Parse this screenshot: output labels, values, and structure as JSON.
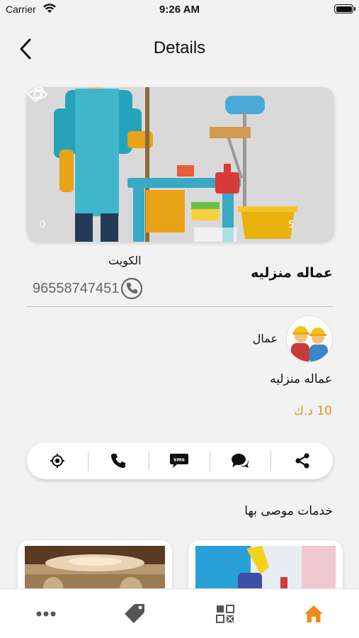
{
  "status_bar": {
    "carrier": "Carrier",
    "time": "9:26 AM"
  },
  "nav": {
    "title": "Details",
    "back_icon": "chevron-left-icon"
  },
  "hero": {
    "likes": "0",
    "views": "5",
    "image": "cleaning-worker-illustration"
  },
  "service": {
    "title": "عماله منزليه",
    "city": "الكويت",
    "phone": "96558747451"
  },
  "provider": {
    "name": "عمال",
    "avatar": "workers-avatar"
  },
  "details": {
    "category": "عماله منزليه",
    "price": "10 د.ك"
  },
  "actions": [
    {
      "name": "location",
      "icon": "location-target-icon"
    },
    {
      "name": "call",
      "icon": "phone-icon"
    },
    {
      "name": "sms",
      "icon": "sms-icon"
    },
    {
      "name": "chat",
      "icon": "chat-icon"
    },
    {
      "name": "share",
      "icon": "share-icon"
    }
  ],
  "recommended": {
    "title": "خدمات موصى بها",
    "cards": [
      {
        "image": "interior-ceiling-photo"
      },
      {
        "image": "cleaning-gloves-photo"
      }
    ]
  },
  "tab_bar": {
    "items": [
      {
        "name": "more",
        "icon": "more-dots-icon"
      },
      {
        "name": "offers",
        "icon": "tag-icon"
      },
      {
        "name": "categories",
        "icon": "grid-icon"
      },
      {
        "name": "home",
        "icon": "home-icon",
        "active": true
      }
    ],
    "accent_color": "#f08a1c"
  },
  "colors": {
    "accent": "#e8901e",
    "background": "#f2f2f2"
  }
}
